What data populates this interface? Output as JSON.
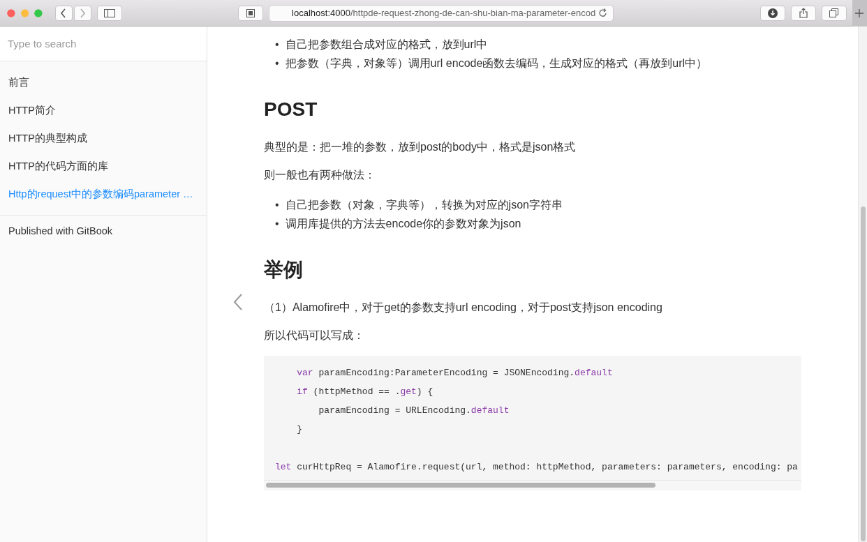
{
  "browser": {
    "address_bar": {
      "host": "localhost:4000",
      "path": "/httpde-request-zhong-de-can-shu-bian-ma-parameter-encod"
    }
  },
  "sidebar": {
    "search": {
      "placeholder": "Type to search"
    },
    "items": [
      {
        "label": "前言",
        "selected": false
      },
      {
        "label": "HTTP简介",
        "selected": false
      },
      {
        "label": "HTTP的典型构成",
        "selected": false
      },
      {
        "label": "HTTP的代码方面的库",
        "selected": false
      },
      {
        "label": "Http的request中的参数编码parameter …",
        "selected": true
      }
    ],
    "footer": "Published with GitBook"
  },
  "content": [
    {
      "kind": "bullets",
      "marker": "•",
      "items": [
        "自己把参数组合成对应的格式，放到url中",
        "把参数（字典，对象等）调用url encode函数去编码，生成对应的格式（再放到url中）"
      ]
    },
    {
      "kind": "heading",
      "text": "POST"
    },
    {
      "kind": "paragraph",
      "text": "典型的是：把一堆的参数，放到post的body中，格式是json格式"
    },
    {
      "kind": "paragraph",
      "text": "则一般也有两种做法："
    },
    {
      "kind": "bullets",
      "marker": "•",
      "items": [
        "自己把参数（对象，字典等），转换为对应的json字符串",
        "调用库提供的方法去encode你的参数对象为json"
      ]
    },
    {
      "kind": "heading",
      "text": "举例"
    },
    {
      "kind": "paragraph",
      "text": "（1）Alamofire中，对于get的参数支持url encoding，对于post支持json encoding"
    },
    {
      "kind": "paragraph",
      "text": "所以代码可以写成："
    },
    {
      "kind": "code",
      "groups": [
        [
          {
            "tokens": [
              {
                "text": "    var",
                "kind": "keyword"
              },
              {
                "text": " paramEncoding:ParameterEncoding = JSONEncoding.",
                "kind": "plain"
              },
              {
                "text": "default",
                "kind": "keyword"
              }
            ]
          },
          {
            "tokens": [
              {
                "text": "    if",
                "kind": "keyword"
              },
              {
                "text": " (httpMethod == .",
                "kind": "plain"
              },
              {
                "text": "get",
                "kind": "keyword"
              },
              {
                "text": ") {",
                "kind": "plain"
              }
            ]
          },
          {
            "tokens": [
              {
                "text": "        paramEncoding = URLEncoding.",
                "kind": "plain"
              },
              {
                "text": "default",
                "kind": "keyword"
              }
            ]
          },
          {
            "tokens": [
              {
                "text": "    }",
                "kind": "plain"
              }
            ]
          }
        ],
        [
          {
            "tokens": [
              {
                "text": "let",
                "kind": "keyword"
              },
              {
                "text": " curHttpReq = Alamofire.request(url, method: httpMethod, parameters: parameters, encoding: pa",
                "kind": "plain"
              }
            ]
          }
        ]
      ]
    }
  ]
}
